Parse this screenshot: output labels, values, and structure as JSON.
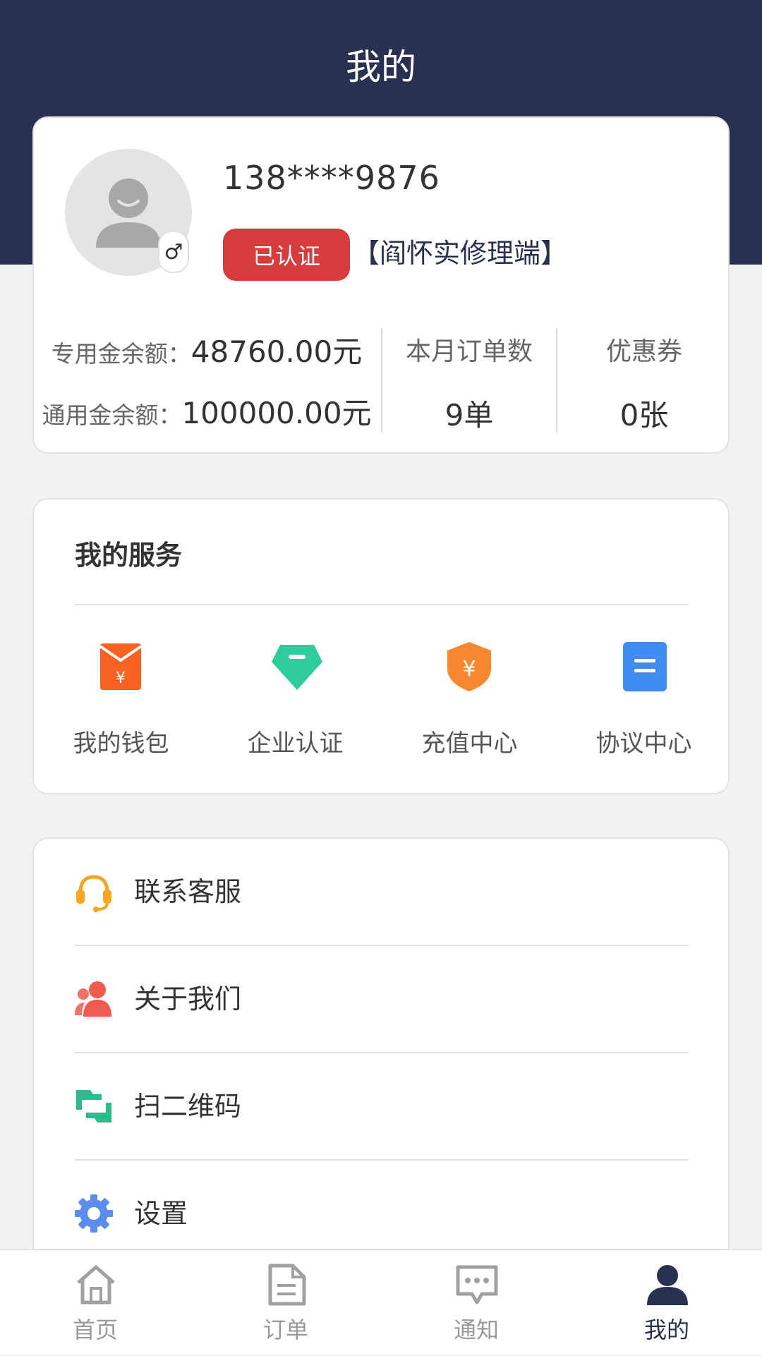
{
  "header": {
    "title": "我的"
  },
  "profile": {
    "phone": "138****9876",
    "gender_symbol": "♂",
    "cert_label": "已认证",
    "company": "【阎怀实修理端】",
    "dedicated_balance_label": "专用金余额：",
    "dedicated_balance_value": "48760.00元",
    "general_balance_label": "通用金余额：",
    "general_balance_value": "100000.00元",
    "monthly_orders_label": "本月订单数",
    "monthly_orders_value": "9单",
    "coupons_label": "优惠券",
    "coupons_value": "0张"
  },
  "services": {
    "title": "我的服务",
    "items": [
      {
        "label": "我的钱包",
        "icon": "wallet-icon",
        "color": "#fa6223"
      },
      {
        "label": "企业认证",
        "icon": "diamond-icon",
        "color": "#2ecc9a"
      },
      {
        "label": "充值中心",
        "icon": "shield-yen-icon",
        "color": "#f7882f"
      },
      {
        "label": "协议中心",
        "icon": "document-icon",
        "color": "#3f8cf5"
      }
    ]
  },
  "menu": {
    "items": [
      {
        "label": "联系客服",
        "icon": "headset-icon",
        "color": "#f5a623"
      },
      {
        "label": "关于我们",
        "icon": "users-icon",
        "color": "#f05a4f"
      },
      {
        "label": "扫二维码",
        "icon": "scan-icon",
        "color": "#2dbb8a"
      },
      {
        "label": "设置",
        "icon": "gear-icon",
        "color": "#5b8def"
      }
    ]
  },
  "tabbar": {
    "items": [
      {
        "label": "首页",
        "icon": "home-icon",
        "active": false
      },
      {
        "label": "订单",
        "icon": "order-icon",
        "active": false
      },
      {
        "label": "通知",
        "icon": "message-icon",
        "active": false
      },
      {
        "label": "我的",
        "icon": "person-icon",
        "active": true
      }
    ]
  },
  "colors": {
    "header_bg": "#283150",
    "cert_badge": "#d73c3c",
    "active_tab": "#283150",
    "inactive_tab": "#999999"
  }
}
